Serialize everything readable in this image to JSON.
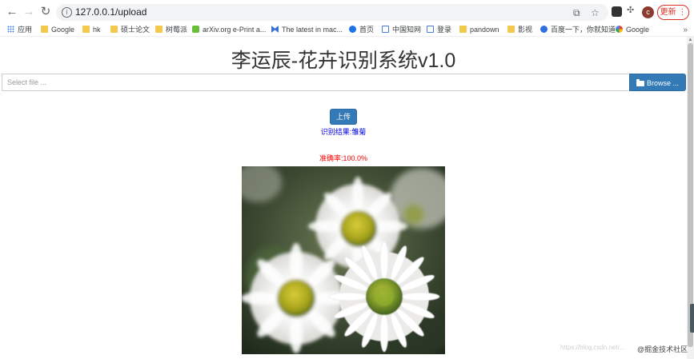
{
  "browser": {
    "url": "127.0.0.1/upload",
    "update_label": "更新",
    "avatar_letter": "c",
    "bookmarks": [
      {
        "label": "应用",
        "icon": "apps-grid-icon"
      },
      {
        "label": "Google",
        "icon": "folder-icon"
      },
      {
        "label": "hk",
        "icon": "folder-icon"
      },
      {
        "label": "硕士论文",
        "icon": "folder-icon"
      },
      {
        "label": "树莓派",
        "icon": "folder-icon"
      },
      {
        "label": "arXiv.org e-Print a...",
        "icon": "arxiv-icon"
      },
      {
        "label": "The latest in mac...",
        "icon": "butterfly-icon"
      },
      {
        "label": "首页",
        "icon": "globe-icon"
      },
      {
        "label": "中国知网",
        "icon": "cnki-icon"
      },
      {
        "label": "登录",
        "icon": "cnki-icon"
      },
      {
        "label": "pandown",
        "icon": "folder-icon"
      },
      {
        "label": "影视",
        "icon": "folder-icon"
      },
      {
        "label": "百度一下，你就知道",
        "icon": "baidu-paw-icon"
      },
      {
        "label": "Google",
        "icon": "google-icon"
      }
    ],
    "more_label": "»"
  },
  "page": {
    "title": "李运辰-花卉识别系统v1.0",
    "file_placeholder": "Select file ...",
    "browse_label": "Browse ...",
    "upload_label": "上传",
    "result_text": "识别结果:雏菊",
    "accuracy_text": "准确率:100.0%"
  },
  "watermark": {
    "faint": "https://blog.csdn.net/...",
    "label": "@掘金技术社区"
  },
  "colors": {
    "primary": "#337ab7",
    "result": "#0000ee",
    "accuracy": "#ff0000"
  }
}
